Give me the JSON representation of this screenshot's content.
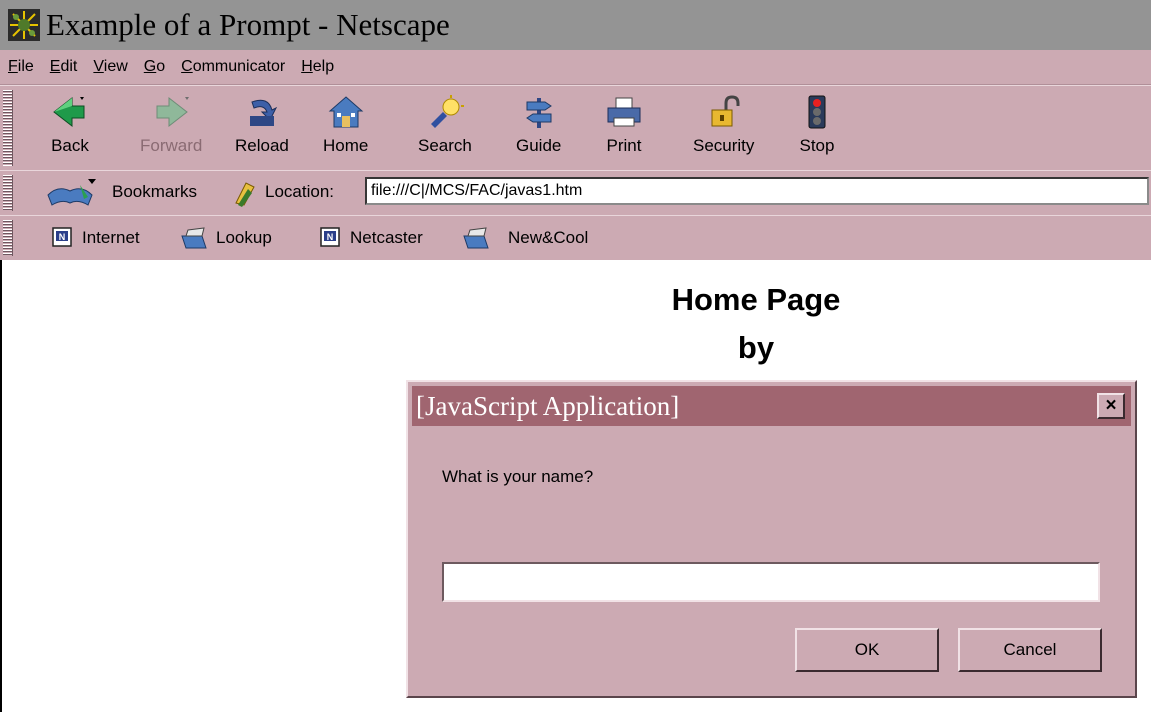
{
  "window": {
    "title": "Example of a Prompt - Netscape"
  },
  "menu": {
    "items": [
      {
        "underline": "F",
        "rest": "ile"
      },
      {
        "underline": "E",
        "rest": "dit"
      },
      {
        "underline": "V",
        "rest": "iew"
      },
      {
        "underline": "G",
        "rest": "o"
      },
      {
        "underline": "C",
        "rest": "ommunicator"
      },
      {
        "underline": "H",
        "rest": "elp"
      }
    ]
  },
  "toolbar": {
    "back": "Back",
    "forward": "Forward",
    "reload": "Reload",
    "home": "Home",
    "search": "Search",
    "guide": "Guide",
    "print": "Print",
    "security": "Security",
    "stop": "Stop"
  },
  "location_bar": {
    "bookmarks": "Bookmarks",
    "location_label": "Location:",
    "url": "file:///C|/MCS/FAC/javas1.htm"
  },
  "personal_toolbar": {
    "items": [
      "Internet",
      "Lookup",
      "Netcaster",
      "New&Cool"
    ]
  },
  "page": {
    "heading_line1": "Home Page",
    "heading_line2": "by"
  },
  "dialog": {
    "title": "[JavaScript Application]",
    "close_glyph": "×",
    "prompt": "What is your name?",
    "input_value": "",
    "ok_label": "OK",
    "cancel_label": "Cancel"
  },
  "colors": {
    "chrome": "#ccaab3",
    "title_bar": "#949494",
    "dialog_title": "#a06570"
  }
}
